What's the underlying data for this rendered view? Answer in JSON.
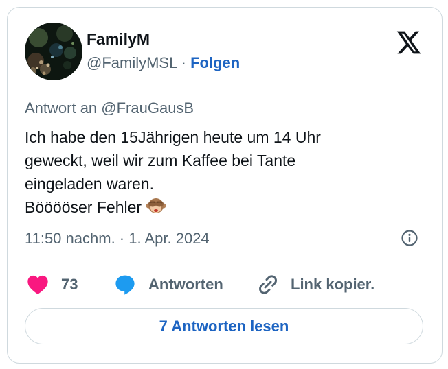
{
  "author": {
    "name": "FamilyM",
    "handle": "@FamilyMSL",
    "separator": "·",
    "follow_label": "Folgen"
  },
  "tweet": {
    "reply_to": "Antwort an @FrauGausB",
    "lines": [
      "Ich habe den 15Jährigen heute um 14 Uhr",
      "geweckt, weil wir zum Kaffee bei Tante",
      "eingeladen waren.",
      "Bööööser Fehler"
    ],
    "emoji_icon": "see-no-evil-monkey-icon",
    "timestamp": "11:50 nachm. · 1. Apr. 2024"
  },
  "actions": {
    "like_count": "73",
    "reply_label": "Antworten",
    "copy_label": "Link kopier."
  },
  "read_replies_label": "7 Antworten lesen",
  "colors": {
    "like": "#f91880",
    "reply": "#1d9bf0",
    "link": "#1d64c2",
    "muted": "#536471",
    "text": "#0f1419",
    "border": "#cfd9de"
  }
}
